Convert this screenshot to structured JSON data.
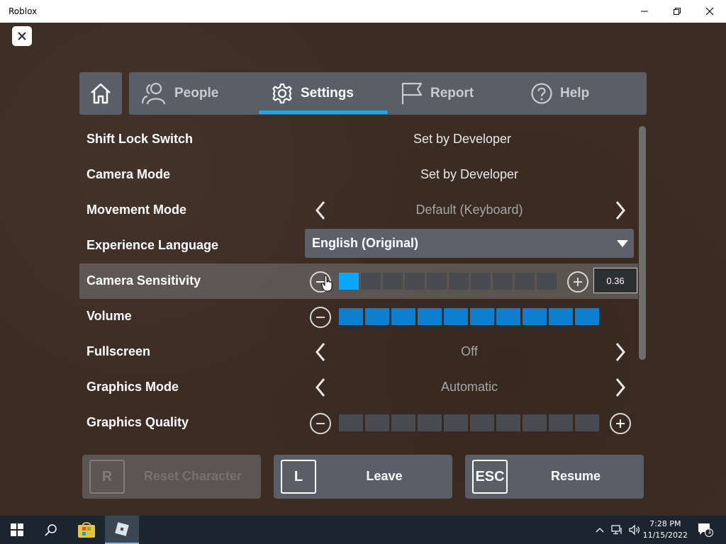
{
  "window": {
    "title": "Roblox"
  },
  "tabs": [
    {
      "label": "People",
      "icon": "people-icon"
    },
    {
      "label": "Settings",
      "icon": "gear-icon",
      "active": true
    },
    {
      "label": "Report",
      "icon": "flag-icon"
    },
    {
      "label": "Help",
      "icon": "help-icon"
    }
  ],
  "settings": {
    "shift_lock": {
      "label": "Shift Lock Switch",
      "value": "Set by Developer"
    },
    "camera_mode": {
      "label": "Camera Mode",
      "value": "Set by Developer"
    },
    "movement_mode": {
      "label": "Movement Mode",
      "value": "Default (Keyboard)"
    },
    "language": {
      "label": "Experience Language",
      "value": "English (Original)"
    },
    "camera_sensitivity": {
      "label": "Camera Sensitivity",
      "value": "0.36",
      "level": 1,
      "max": 10
    },
    "volume": {
      "label": "Volume",
      "level": 10,
      "max": 10
    },
    "fullscreen": {
      "label": "Fullscreen",
      "value": "Off"
    },
    "graphics_mode": {
      "label": "Graphics Mode",
      "value": "Automatic"
    },
    "graphics_quality": {
      "label": "Graphics Quality",
      "level": 0,
      "max": 10
    }
  },
  "buttons": {
    "reset": {
      "key": "R",
      "label": "Reset Character"
    },
    "leave": {
      "key": "L",
      "label": "Leave"
    },
    "resume": {
      "key": "ESC",
      "label": "Resume"
    }
  },
  "taskbar": {
    "time": "7:28 PM",
    "date": "11/15/2022",
    "notifications": "1"
  },
  "colors": {
    "accent": "#27a2ef",
    "slider_on": "#0d7fcf",
    "panel": "#5a5e66"
  }
}
